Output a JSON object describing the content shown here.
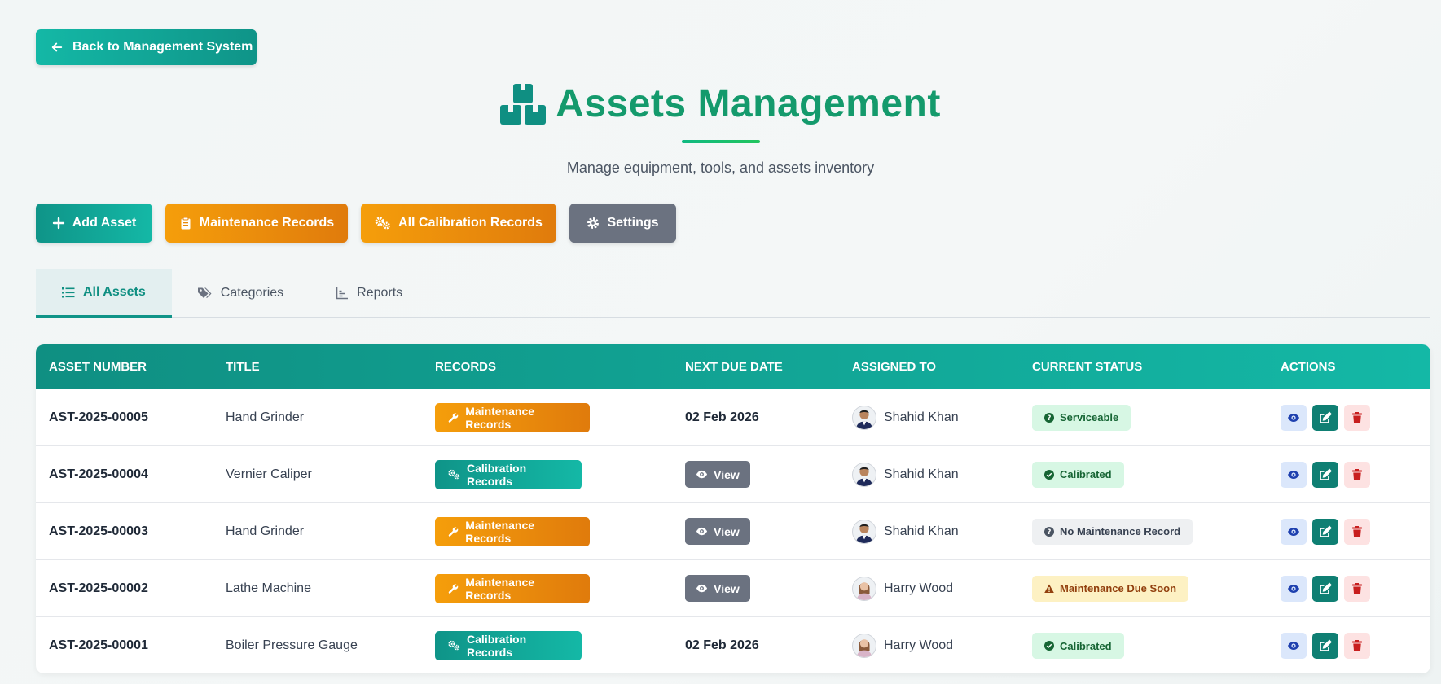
{
  "back_button": {
    "label": "Back to Management System",
    "icon": "arrow-left-icon"
  },
  "header": {
    "title": "Assets Management",
    "icon": "boxes-icon",
    "subtitle": "Manage equipment, tools, and assets inventory"
  },
  "actions": {
    "add_asset": "Add Asset",
    "maintenance_records": "Maintenance Records",
    "all_calibration_records": "All Calibration Records",
    "settings": "Settings"
  },
  "tabs": [
    {
      "label": "All Assets",
      "icon": "list-icon",
      "active": true
    },
    {
      "label": "Categories",
      "icon": "tags-icon",
      "active": false
    },
    {
      "label": "Reports",
      "icon": "chart-icon",
      "active": false
    }
  ],
  "table": {
    "headers": [
      "ASSET NUMBER",
      "TITLE",
      "RECORDS",
      "NEXT DUE DATE",
      "ASSIGNED TO",
      "CURRENT STATUS",
      "ACTIONS"
    ],
    "rows": [
      {
        "asset_number": "AST-2025-00005",
        "title": "Hand Grinder",
        "records": "Maintenance Records",
        "records_type": "maintenance",
        "due": "02 Feb 2026",
        "due_type": "date",
        "assigned": "Shahid Khan",
        "status": "Serviceable",
        "status_type": "green",
        "status_icon": "question-circle-icon"
      },
      {
        "asset_number": "AST-2025-00004",
        "title": "Vernier Caliper",
        "records": "Calibration Records",
        "records_type": "calibration",
        "due": "View",
        "due_type": "view",
        "assigned": "Shahid Khan",
        "status": "Calibrated",
        "status_type": "green",
        "status_icon": "check-circle-icon"
      },
      {
        "asset_number": "AST-2025-00003",
        "title": "Hand Grinder",
        "records": "Maintenance Records",
        "records_type": "maintenance",
        "due": "View",
        "due_type": "view",
        "assigned": "Shahid Khan",
        "status": "No Maintenance Record",
        "status_type": "gray",
        "status_icon": "question-circle-icon"
      },
      {
        "asset_number": "AST-2025-00002",
        "title": "Lathe Machine",
        "records": "Maintenance Records",
        "records_type": "maintenance",
        "due": "View",
        "due_type": "view",
        "assigned": "Harry Wood",
        "status": "Maintenance Due Soon",
        "status_type": "yellow",
        "status_icon": "warning-icon"
      },
      {
        "asset_number": "AST-2025-00001",
        "title": "Boiler Pressure Gauge",
        "records": "Calibration Records",
        "records_type": "calibration",
        "due": "02 Feb 2026",
        "due_type": "date",
        "assigned": "Harry Wood",
        "status": "Calibrated",
        "status_type": "green",
        "status_icon": "check-circle-icon"
      }
    ]
  },
  "colors": {
    "primary_teal": "#0f9488",
    "orange": "#f59e0b",
    "title_green": "#149a6c",
    "gray_button": "#6b7280"
  }
}
